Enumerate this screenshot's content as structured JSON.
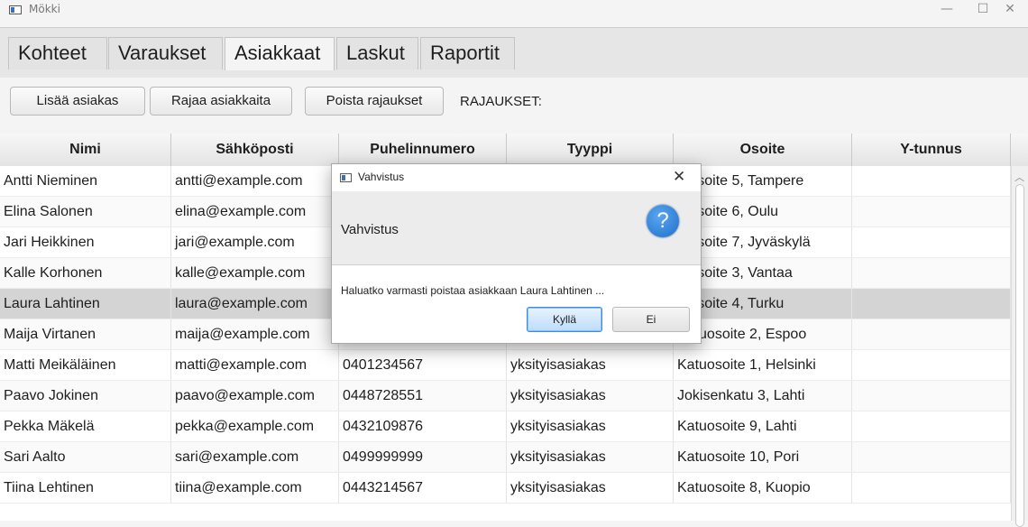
{
  "window": {
    "title": "Mökki",
    "min_symbol": "—",
    "max_symbol": "☐",
    "close_symbol": "✕"
  },
  "tabs": [
    {
      "label": "Kohteet",
      "active": false
    },
    {
      "label": "Varaukset",
      "active": false
    },
    {
      "label": "Asiakkaat",
      "active": true
    },
    {
      "label": "Laskut",
      "active": false
    },
    {
      "label": "Raportit",
      "active": false
    }
  ],
  "toolbar": {
    "add_label": "Lisää asiakas",
    "filter_label": "Rajaa asiakkaita",
    "clear_label": "Poista rajaukset",
    "filters_label": "RAJAUKSET:"
  },
  "table": {
    "columns": [
      "Nimi",
      "Sähköposti",
      "Puhelinnumero",
      "Tyyppi",
      "Osoite",
      "Y-tunnus"
    ],
    "rows": [
      {
        "nimi": "Antti Nieminen",
        "email": "antti@example.com",
        "phone": "",
        "type": "",
        "address": "tuosoite 5, Tampere",
        "ytunnus": ""
      },
      {
        "nimi": "Elina Salonen",
        "email": "elina@example.com",
        "phone": "",
        "type": "",
        "address": "tuosoite 6, Oulu",
        "ytunnus": ""
      },
      {
        "nimi": "Jari Heikkinen",
        "email": "jari@example.com",
        "phone": "",
        "type": "",
        "address": "tuosoite 7, Jyväskylä",
        "ytunnus": ""
      },
      {
        "nimi": "Kalle Korhonen",
        "email": "kalle@example.com",
        "phone": "",
        "type": "",
        "address": "tuosoite 3, Vantaa",
        "ytunnus": ""
      },
      {
        "nimi": "Laura Lahtinen",
        "email": "laura@example.com",
        "phone": "",
        "type": "",
        "address": "tuosoite 4, Turku",
        "ytunnus": "",
        "selected": true
      },
      {
        "nimi": "Maija Virtanen",
        "email": "maija@example.com",
        "phone": "0507654321",
        "type": "yksityisasiakas",
        "address": "Katuosoite 2, Espoo",
        "ytunnus": ""
      },
      {
        "nimi": "Matti Meikäläinen",
        "email": "matti@example.com",
        "phone": "0401234567",
        "type": "yksityisasiakas",
        "address": "Katuosoite 1, Helsinki",
        "ytunnus": ""
      },
      {
        "nimi": "Paavo Jokinen",
        "email": "paavo@example.com",
        "phone": "0448728551",
        "type": "yksityisasiakas",
        "address": "Jokisenkatu 3, Lahti",
        "ytunnus": ""
      },
      {
        "nimi": "Pekka Mäkelä",
        "email": "pekka@example.com",
        "phone": "0432109876",
        "type": "yksityisasiakas",
        "address": "Katuosoite 9, Lahti",
        "ytunnus": ""
      },
      {
        "nimi": "Sari Aalto",
        "email": "sari@example.com",
        "phone": "0499999999",
        "type": "yksityisasiakas",
        "address": "Katuosoite 10, Pori",
        "ytunnus": ""
      },
      {
        "nimi": "Tiina Lehtinen",
        "email": "tiina@example.com",
        "phone": "0443214567",
        "type": "yksityisasiakas",
        "address": "Katuosoite 8, Kuopio",
        "ytunnus": ""
      }
    ]
  },
  "dialog": {
    "title": "Vahvistus",
    "header": "Vahvistus",
    "icon_glyph": "?",
    "content": "Haluatko varmasti poistaa asiakkaan Laura Lahtinen ...",
    "yes_label": "Kyllä",
    "no_label": "Ei",
    "close_symbol": "✕"
  },
  "icons": {
    "app": "app-window-icon",
    "question": "question-icon",
    "scroll_up": "chevron-up-icon"
  }
}
